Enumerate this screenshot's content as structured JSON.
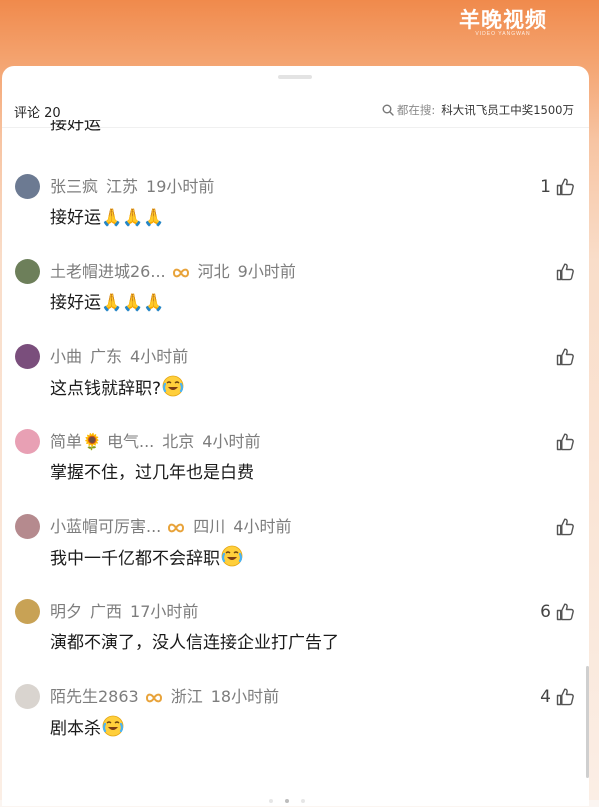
{
  "watermark": {
    "title": "羊晚视频",
    "subtitle": "VIDEO YANGWAN"
  },
  "header": {
    "count_label": "评论 20",
    "search_prefix": "都在搜:",
    "search_term": "科大讯飞员工中奖1500万"
  },
  "partial_comment_text": "接好运",
  "comments": [
    {
      "user": "张三疯",
      "location": "江苏",
      "time": "19小时前",
      "text": "接好运🙏🙏🙏",
      "likes": "1",
      "badge": false,
      "emoji_icon": "",
      "avatar_color": "#6c7a92"
    },
    {
      "user": "土老帽进城26...",
      "location": "河北",
      "time": "9小时前",
      "text": "接好运🙏🙏🙏",
      "likes": "",
      "badge": true,
      "emoji_icon": "",
      "avatar_color": "#6d7f5a"
    },
    {
      "user": "小曲",
      "location": "广东",
      "time": "4小时前",
      "text": "这点钱就辞职?",
      "likes": "",
      "badge": false,
      "emoji_icon": "laughing-crying-emoji",
      "avatar_color": "#7a4e7c"
    },
    {
      "user": "简单🌻 电气...",
      "location": "北京",
      "time": "4小时前",
      "text": "掌握不住，过几年也是白费",
      "likes": "",
      "badge": false,
      "emoji_icon": "",
      "avatar_color": "#e8a0b4"
    },
    {
      "user": "小蓝帽可厉害...",
      "location": "四川",
      "time": "4小时前",
      "text": "我中一千亿都不会辞职",
      "likes": "",
      "badge": true,
      "emoji_icon": "laughing-crying-emoji",
      "avatar_color": "#b58a8e"
    },
    {
      "user": "明夕",
      "location": "广西",
      "time": "17小时前",
      "text": "演都不演了，没人信连接企业打广告了",
      "likes": "6",
      "badge": false,
      "emoji_icon": "",
      "avatar_color": "#c8a255"
    },
    {
      "user": "陌先生2863",
      "location": "浙江",
      "time": "18小时前",
      "text": "剧本杀",
      "likes": "4",
      "badge": true,
      "emoji_icon": "laughing-crying-emoji",
      "avatar_color": "#d9d4cf"
    }
  ],
  "colors": {
    "badge": "#e8a33a",
    "meta_text": "#7d7d7d",
    "body_text": "#1a1a1a"
  }
}
